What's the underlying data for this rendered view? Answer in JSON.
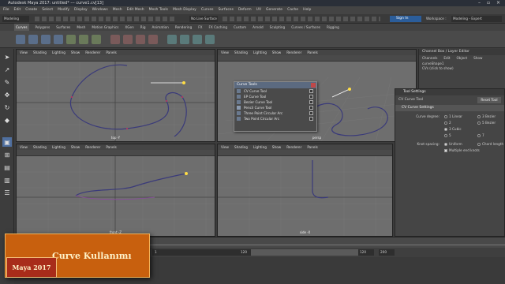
{
  "window": {
    "title": "Autodesk Maya 2017: untitled*   ---   curve1.cv[13]"
  },
  "menubar": [
    "File",
    "Edit",
    "Create",
    "Select",
    "Modify",
    "Display",
    "Windows",
    "Mesh",
    "Edit Mesh",
    "Mesh Tools",
    "Mesh Display",
    "Curves",
    "Surfaces",
    "Deform",
    "UV",
    "Generate",
    "Cache",
    "Help"
  ],
  "statusline": {
    "mode": "Modeling",
    "live_surface": "No Live Surface",
    "sign_in": "Sign In",
    "workspace_label": "Workspace :",
    "workspace_value": "Modeling - Expert"
  },
  "shelf_tabs": [
    {
      "label": "Curves",
      "active": true
    },
    {
      "label": "Polygons",
      "active": false
    },
    {
      "label": "Surfaces",
      "active": false
    },
    {
      "label": "Mesh",
      "active": false
    },
    {
      "label": "Motion Graphics",
      "active": false
    },
    {
      "label": "XGen",
      "active": false
    },
    {
      "label": "Rig",
      "active": false
    },
    {
      "label": "Animation",
      "active": false
    },
    {
      "label": "Rendering",
      "active": false
    },
    {
      "label": "FX",
      "active": false
    },
    {
      "label": "FX Caching",
      "active": false
    },
    {
      "label": "Custom",
      "active": false
    },
    {
      "label": "Arnold",
      "active": false
    },
    {
      "label": "Sculpting",
      "active": false
    },
    {
      "label": "Curves / Surfaces",
      "active": false
    },
    {
      "label": "Rigging",
      "active": false
    }
  ],
  "viewport_menu": [
    "View",
    "Shading",
    "Lighting",
    "Show",
    "Renderer",
    "Panels"
  ],
  "viewports": [
    {
      "label": "top -Y"
    },
    {
      "label": "persp"
    },
    {
      "label": "front -Z"
    },
    {
      "label": "side -X"
    }
  ],
  "channel_box": {
    "title": "Channel Box / Layer Editor",
    "menu": [
      "Channels",
      "Edit",
      "Object",
      "Show"
    ],
    "object": "curveShape1",
    "cvs": "CVs (click to show)"
  },
  "curve_tools": {
    "title": "Curve Tools",
    "items": [
      {
        "label": "CV Curve Tool",
        "checked": false
      },
      {
        "label": "EP Curve Tool",
        "checked": false
      },
      {
        "label": "Bezier Curve Tool",
        "checked": false
      },
      {
        "label": "Pencil Curve Tool",
        "checked": true
      },
      {
        "label": "Three Point Circular Arc",
        "checked": false
      },
      {
        "label": "Two Point Circular Arc",
        "checked": false
      }
    ]
  },
  "tool_settings": {
    "title": "Tool Settings",
    "tool_name": "CV Curve Tool",
    "reset_label": "Reset Tool",
    "section": "CV Curve Settings",
    "curve_degree_label": "Curve degree:",
    "degree_options": [
      "1 Linear",
      "2",
      "3 Cubic",
      "5",
      "7"
    ],
    "degree_right": [
      "3 Bezier",
      "5 Bezier"
    ],
    "degree_selected": "3 Cubic",
    "knot_spacing_label": "Knot spacing:",
    "knot_options": [
      "Uniform",
      "Chord length"
    ],
    "knot_selected": "Uniform",
    "multiple_end_knots": "Multiple end knots"
  },
  "timeline": {
    "range_start": "1",
    "range_marker": "120",
    "range_end": "120",
    "range_end2": "200"
  },
  "banner": {
    "title": "Curve Kullanımı",
    "badge": "Maya 2017"
  },
  "colors": {
    "accent": "#c8600e",
    "badge": "#a82c1a",
    "curve": "#3a3a7a",
    "highlight": "#ffdd44"
  }
}
